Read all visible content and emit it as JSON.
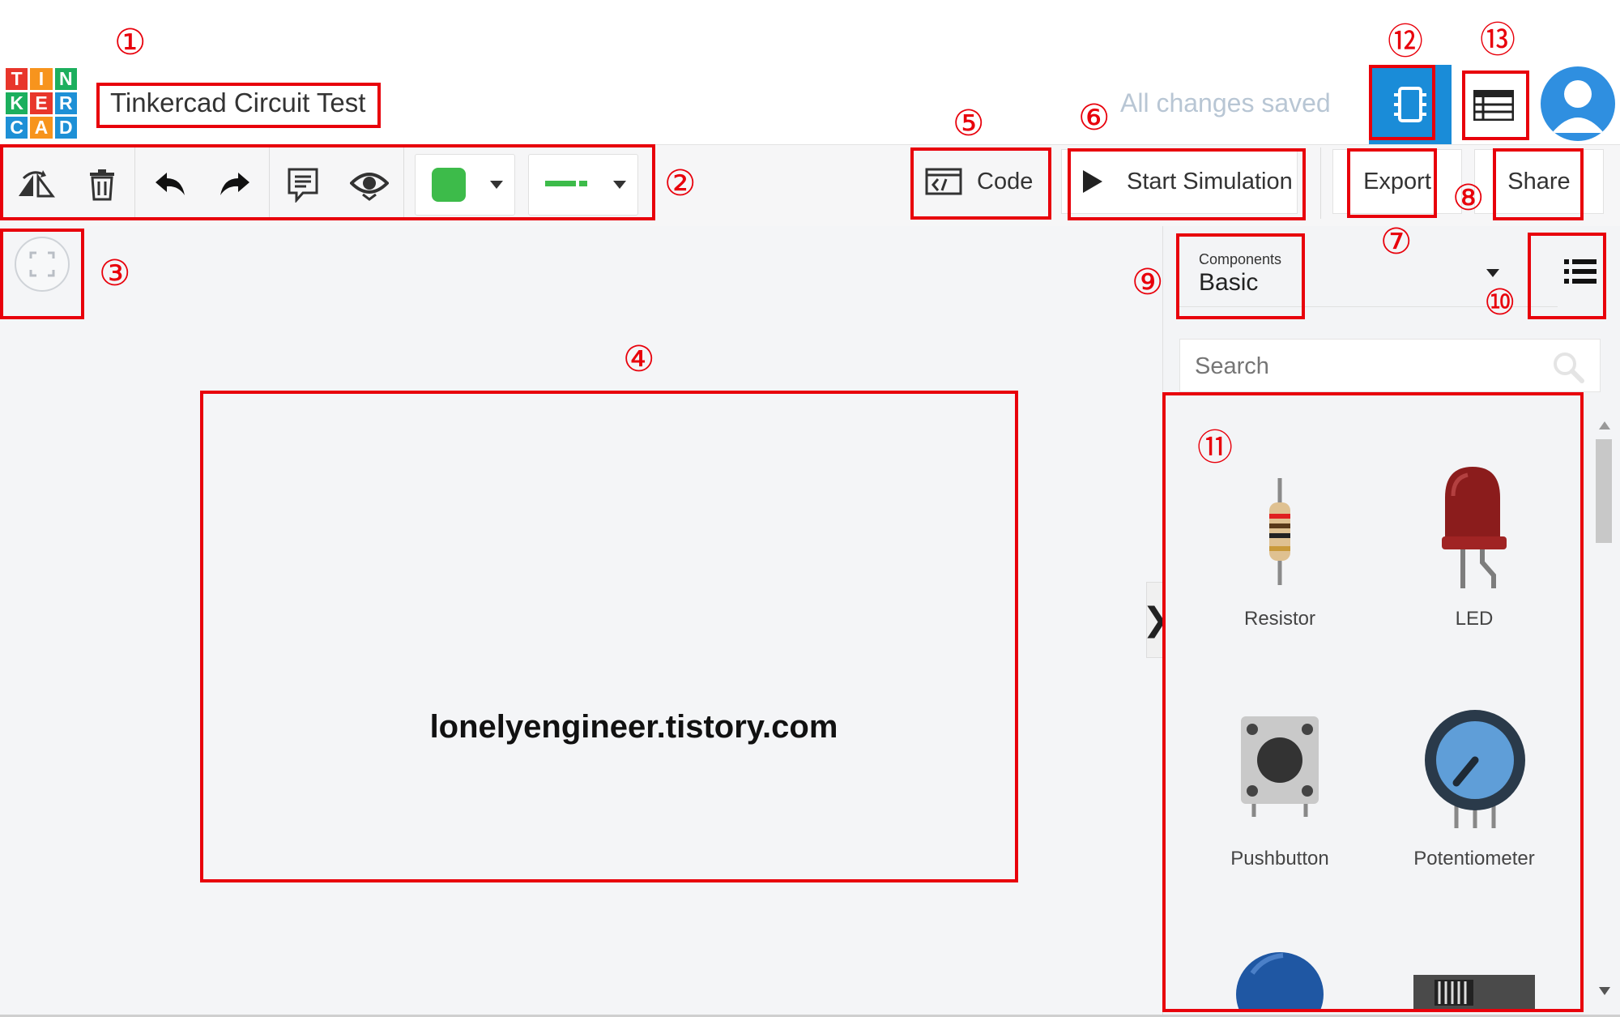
{
  "header": {
    "logo_letters": [
      "T",
      "I",
      "N",
      "K",
      "E",
      "R",
      "C",
      "A",
      "D"
    ],
    "logo_colors": [
      "#e8362b",
      "#f7941d",
      "#1caf5d",
      "#1caf5d",
      "#e8362b",
      "#1e90d6",
      "#1e90d6",
      "#f7941d",
      "#1e90d6"
    ],
    "project_title": "Tinkercad Circuit Test",
    "save_status": "All changes saved",
    "avatar_icon": "user-avatar-icon"
  },
  "toolbar": {
    "icons": [
      "rotate-icon",
      "delete-icon",
      "undo-icon",
      "redo-icon",
      "notes-icon",
      "visibility-icon"
    ],
    "fill_color": "#3dbb4a",
    "wire_color": "#3dbb4a",
    "code_label": "Code",
    "start_simulation_label": "Start Simulation",
    "export_label": "Export",
    "share_label": "Share"
  },
  "panel": {
    "components_caption": "Components",
    "components_value": "Basic",
    "search_placeholder": "Search",
    "components": [
      {
        "label": "Resistor"
      },
      {
        "label": "LED"
      },
      {
        "label": "Pushbutton"
      },
      {
        "label": "Potentiometer"
      }
    ]
  },
  "canvas": {
    "watermark": "lonelyengineer.tistory.com"
  },
  "annotations": [
    "①",
    "②",
    "③",
    "④",
    "⑤",
    "⑥",
    "⑦",
    "⑧",
    "⑨",
    "⑩",
    "⑪",
    "⑫",
    "⑬"
  ],
  "accent_color": "#1a8cd8",
  "annotation_color": "#e8000b"
}
